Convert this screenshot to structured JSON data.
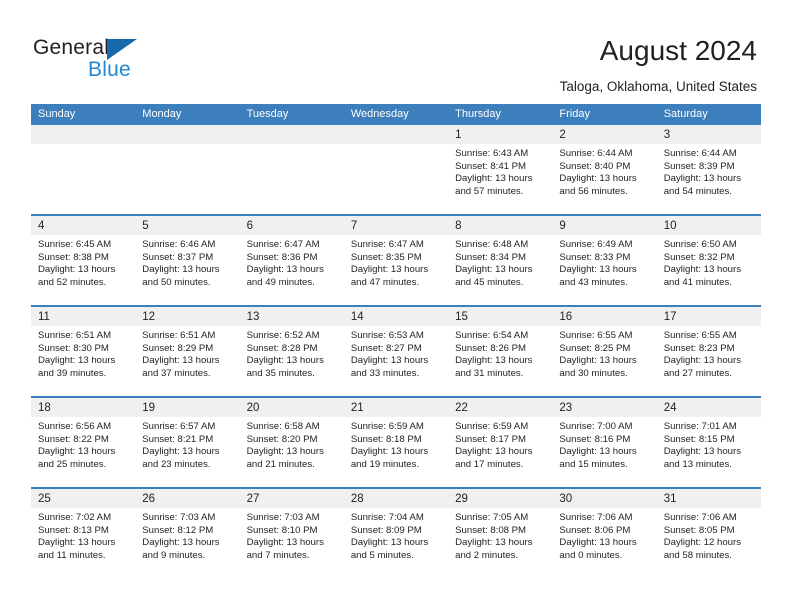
{
  "brand": {
    "name_part1": "General",
    "name_part2": "Blue",
    "triangle_icon": "triangle-icon",
    "color_dark": "#231f20",
    "color_blue": "#2387d4",
    "color_triangle": "#1769ac"
  },
  "header": {
    "title": "August 2024",
    "subtitle": "Taloga, Oklahoma, United States"
  },
  "calendar": {
    "accent_color": "#3d7ebd",
    "band_color": "#f0f0f0",
    "weekday_headers": [
      "Sunday",
      "Monday",
      "Tuesday",
      "Wednesday",
      "Thursday",
      "Friday",
      "Saturday"
    ],
    "weeks": [
      [
        {
          "day": "",
          "sunrise": "",
          "sunset": "",
          "daylight_line1": "",
          "daylight_line2": ""
        },
        {
          "day": "",
          "sunrise": "",
          "sunset": "",
          "daylight_line1": "",
          "daylight_line2": ""
        },
        {
          "day": "",
          "sunrise": "",
          "sunset": "",
          "daylight_line1": "",
          "daylight_line2": ""
        },
        {
          "day": "",
          "sunrise": "",
          "sunset": "",
          "daylight_line1": "",
          "daylight_line2": ""
        },
        {
          "day": "1",
          "sunrise": "Sunrise: 6:43 AM",
          "sunset": "Sunset: 8:41 PM",
          "daylight_line1": "Daylight: 13 hours",
          "daylight_line2": "and 57 minutes."
        },
        {
          "day": "2",
          "sunrise": "Sunrise: 6:44 AM",
          "sunset": "Sunset: 8:40 PM",
          "daylight_line1": "Daylight: 13 hours",
          "daylight_line2": "and 56 minutes."
        },
        {
          "day": "3",
          "sunrise": "Sunrise: 6:44 AM",
          "sunset": "Sunset: 8:39 PM",
          "daylight_line1": "Daylight: 13 hours",
          "daylight_line2": "and 54 minutes."
        }
      ],
      [
        {
          "day": "4",
          "sunrise": "Sunrise: 6:45 AM",
          "sunset": "Sunset: 8:38 PM",
          "daylight_line1": "Daylight: 13 hours",
          "daylight_line2": "and 52 minutes."
        },
        {
          "day": "5",
          "sunrise": "Sunrise: 6:46 AM",
          "sunset": "Sunset: 8:37 PM",
          "daylight_line1": "Daylight: 13 hours",
          "daylight_line2": "and 50 minutes."
        },
        {
          "day": "6",
          "sunrise": "Sunrise: 6:47 AM",
          "sunset": "Sunset: 8:36 PM",
          "daylight_line1": "Daylight: 13 hours",
          "daylight_line2": "and 49 minutes."
        },
        {
          "day": "7",
          "sunrise": "Sunrise: 6:47 AM",
          "sunset": "Sunset: 8:35 PM",
          "daylight_line1": "Daylight: 13 hours",
          "daylight_line2": "and 47 minutes."
        },
        {
          "day": "8",
          "sunrise": "Sunrise: 6:48 AM",
          "sunset": "Sunset: 8:34 PM",
          "daylight_line1": "Daylight: 13 hours",
          "daylight_line2": "and 45 minutes."
        },
        {
          "day": "9",
          "sunrise": "Sunrise: 6:49 AM",
          "sunset": "Sunset: 8:33 PM",
          "daylight_line1": "Daylight: 13 hours",
          "daylight_line2": "and 43 minutes."
        },
        {
          "day": "10",
          "sunrise": "Sunrise: 6:50 AM",
          "sunset": "Sunset: 8:32 PM",
          "daylight_line1": "Daylight: 13 hours",
          "daylight_line2": "and 41 minutes."
        }
      ],
      [
        {
          "day": "11",
          "sunrise": "Sunrise: 6:51 AM",
          "sunset": "Sunset: 8:30 PM",
          "daylight_line1": "Daylight: 13 hours",
          "daylight_line2": "and 39 minutes."
        },
        {
          "day": "12",
          "sunrise": "Sunrise: 6:51 AM",
          "sunset": "Sunset: 8:29 PM",
          "daylight_line1": "Daylight: 13 hours",
          "daylight_line2": "and 37 minutes."
        },
        {
          "day": "13",
          "sunrise": "Sunrise: 6:52 AM",
          "sunset": "Sunset: 8:28 PM",
          "daylight_line1": "Daylight: 13 hours",
          "daylight_line2": "and 35 minutes."
        },
        {
          "day": "14",
          "sunrise": "Sunrise: 6:53 AM",
          "sunset": "Sunset: 8:27 PM",
          "daylight_line1": "Daylight: 13 hours",
          "daylight_line2": "and 33 minutes."
        },
        {
          "day": "15",
          "sunrise": "Sunrise: 6:54 AM",
          "sunset": "Sunset: 8:26 PM",
          "daylight_line1": "Daylight: 13 hours",
          "daylight_line2": "and 31 minutes."
        },
        {
          "day": "16",
          "sunrise": "Sunrise: 6:55 AM",
          "sunset": "Sunset: 8:25 PM",
          "daylight_line1": "Daylight: 13 hours",
          "daylight_line2": "and 30 minutes."
        },
        {
          "day": "17",
          "sunrise": "Sunrise: 6:55 AM",
          "sunset": "Sunset: 8:23 PM",
          "daylight_line1": "Daylight: 13 hours",
          "daylight_line2": "and 27 minutes."
        }
      ],
      [
        {
          "day": "18",
          "sunrise": "Sunrise: 6:56 AM",
          "sunset": "Sunset: 8:22 PM",
          "daylight_line1": "Daylight: 13 hours",
          "daylight_line2": "and 25 minutes."
        },
        {
          "day": "19",
          "sunrise": "Sunrise: 6:57 AM",
          "sunset": "Sunset: 8:21 PM",
          "daylight_line1": "Daylight: 13 hours",
          "daylight_line2": "and 23 minutes."
        },
        {
          "day": "20",
          "sunrise": "Sunrise: 6:58 AM",
          "sunset": "Sunset: 8:20 PM",
          "daylight_line1": "Daylight: 13 hours",
          "daylight_line2": "and 21 minutes."
        },
        {
          "day": "21",
          "sunrise": "Sunrise: 6:59 AM",
          "sunset": "Sunset: 8:18 PM",
          "daylight_line1": "Daylight: 13 hours",
          "daylight_line2": "and 19 minutes."
        },
        {
          "day": "22",
          "sunrise": "Sunrise: 6:59 AM",
          "sunset": "Sunset: 8:17 PM",
          "daylight_line1": "Daylight: 13 hours",
          "daylight_line2": "and 17 minutes."
        },
        {
          "day": "23",
          "sunrise": "Sunrise: 7:00 AM",
          "sunset": "Sunset: 8:16 PM",
          "daylight_line1": "Daylight: 13 hours",
          "daylight_line2": "and 15 minutes."
        },
        {
          "day": "24",
          "sunrise": "Sunrise: 7:01 AM",
          "sunset": "Sunset: 8:15 PM",
          "daylight_line1": "Daylight: 13 hours",
          "daylight_line2": "and 13 minutes."
        }
      ],
      [
        {
          "day": "25",
          "sunrise": "Sunrise: 7:02 AM",
          "sunset": "Sunset: 8:13 PM",
          "daylight_line1": "Daylight: 13 hours",
          "daylight_line2": "and 11 minutes."
        },
        {
          "day": "26",
          "sunrise": "Sunrise: 7:03 AM",
          "sunset": "Sunset: 8:12 PM",
          "daylight_line1": "Daylight: 13 hours",
          "daylight_line2": "and 9 minutes."
        },
        {
          "day": "27",
          "sunrise": "Sunrise: 7:03 AM",
          "sunset": "Sunset: 8:10 PM",
          "daylight_line1": "Daylight: 13 hours",
          "daylight_line2": "and 7 minutes."
        },
        {
          "day": "28",
          "sunrise": "Sunrise: 7:04 AM",
          "sunset": "Sunset: 8:09 PM",
          "daylight_line1": "Daylight: 13 hours",
          "daylight_line2": "and 5 minutes."
        },
        {
          "day": "29",
          "sunrise": "Sunrise: 7:05 AM",
          "sunset": "Sunset: 8:08 PM",
          "daylight_line1": "Daylight: 13 hours",
          "daylight_line2": "and 2 minutes."
        },
        {
          "day": "30",
          "sunrise": "Sunrise: 7:06 AM",
          "sunset": "Sunset: 8:06 PM",
          "daylight_line1": "Daylight: 13 hours",
          "daylight_line2": "and 0 minutes."
        },
        {
          "day": "31",
          "sunrise": "Sunrise: 7:06 AM",
          "sunset": "Sunset: 8:05 PM",
          "daylight_line1": "Daylight: 12 hours",
          "daylight_line2": "and 58 minutes."
        }
      ]
    ]
  }
}
